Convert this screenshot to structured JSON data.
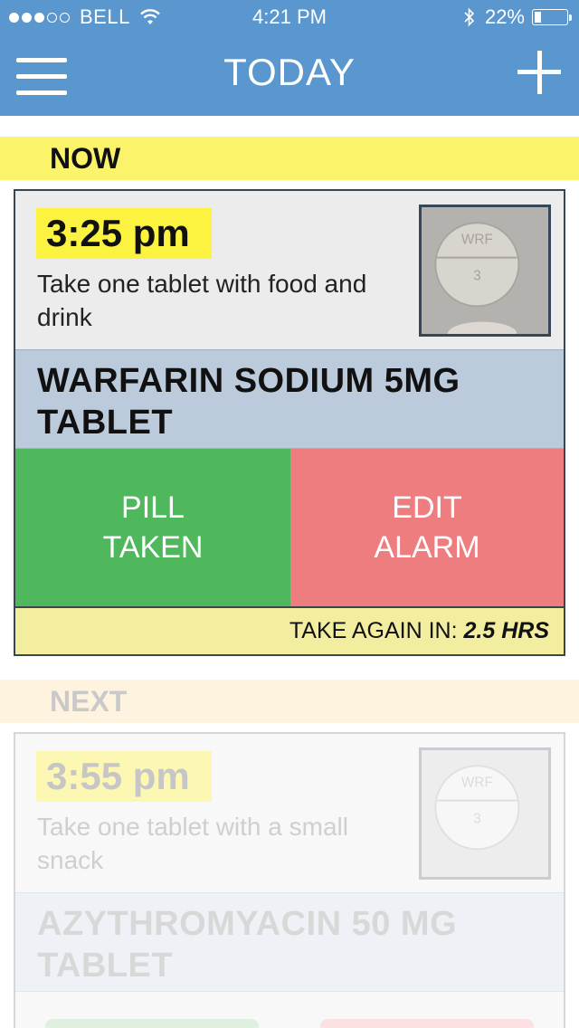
{
  "status_bar": {
    "carrier": "BELL",
    "signal_bars_filled": 3,
    "signal_bars_total": 5,
    "time": "4:21 PM",
    "battery": "22%",
    "battery_level": 0.22
  },
  "nav": {
    "title": "TODAY",
    "menu_icon": "hamburger-menu-icon",
    "add_icon": "plus-icon"
  },
  "sections": {
    "now": "NOW",
    "next": "NEXT"
  },
  "now_card": {
    "time": "3:25 pm",
    "instructions": "Take one tablet with food and drink",
    "pill_imprint": "WRF 3",
    "drug_name": "WARFARIN SODIUM 5MG TABLET",
    "pill_taken_label": "PILL\nTAKEN",
    "edit_alarm_label": "EDIT\nALARM",
    "take_again_label": "TAKE AGAIN IN:",
    "take_again_value": "2.5 HRS"
  },
  "next_card": {
    "time": "3:55 pm",
    "instructions": "Take one tablet with a small snack",
    "pill_imprint": "WRF 3",
    "drug_name": "AZYTHROMYACIN 50 MG TABLET"
  },
  "colors": {
    "header_blue": "#5b97cf",
    "now_yellow": "#fbf46a",
    "pill_taken_green": "#4fb85c",
    "edit_alarm_red": "#ee7d80",
    "drug_band_blue": "#bccbdb"
  }
}
